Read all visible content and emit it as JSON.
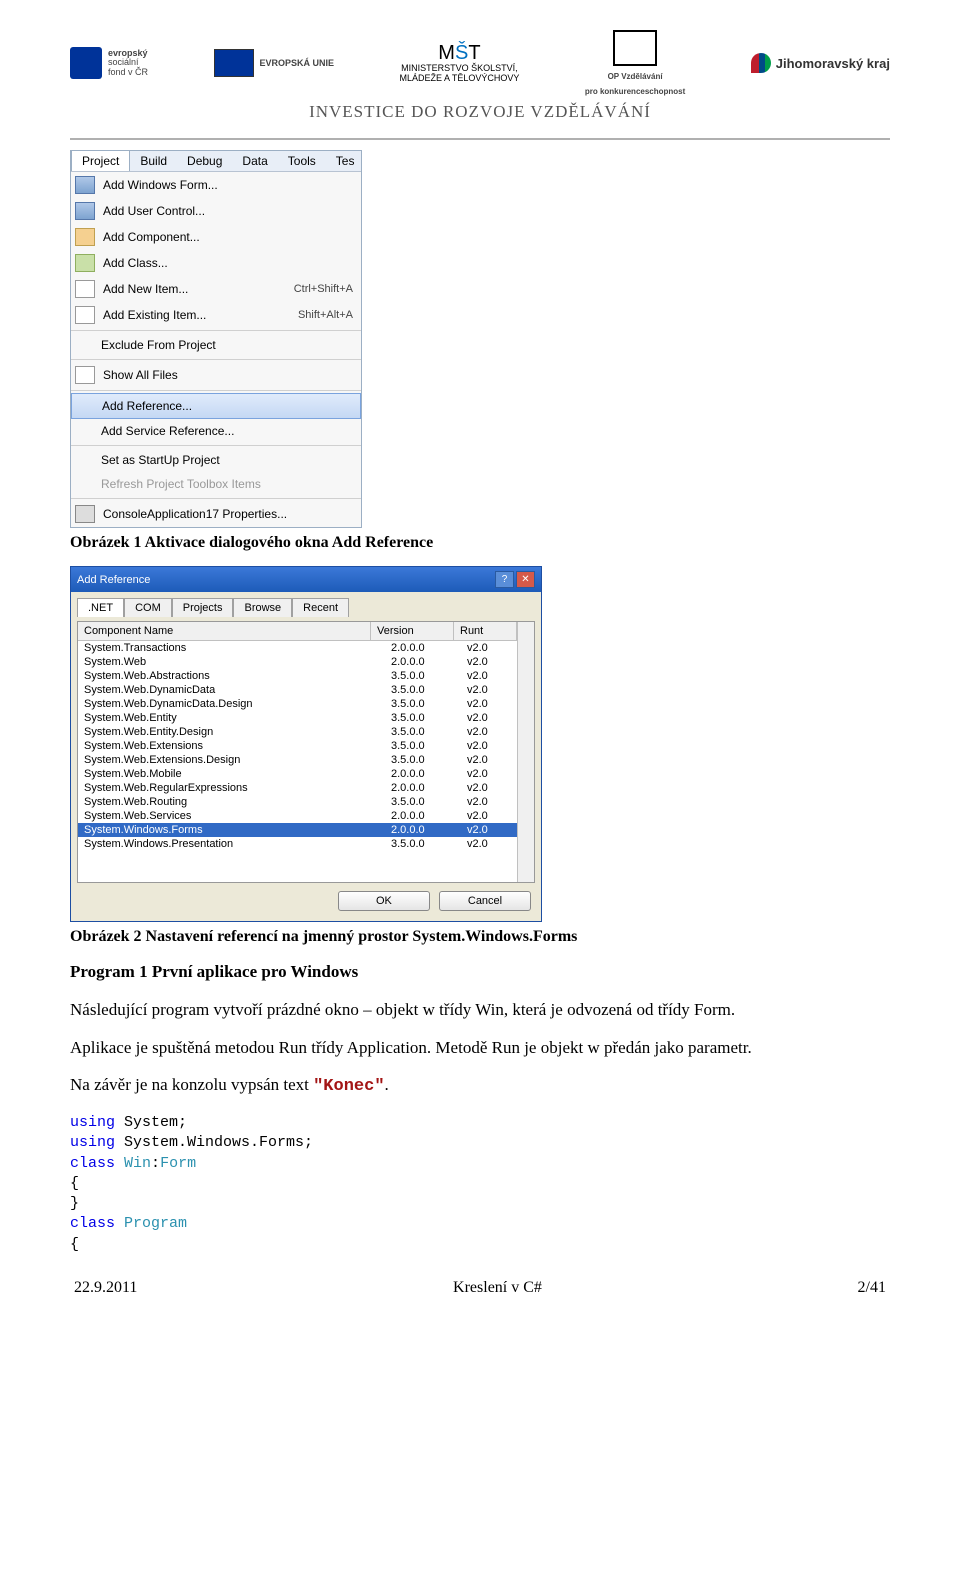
{
  "header": {
    "logos": {
      "esf_lines": [
        "evropský",
        "sociální",
        "fond v ČR"
      ],
      "eu_label": "EVROPSKÁ UNIE",
      "msmt_lines": [
        "MINISTERSTVO ŠKOLSTVÍ,",
        "MLÁDEŽE A TĚLOVÝCHOVY"
      ],
      "opvk_lines": [
        "OP Vzdělávání",
        "pro konkurenceschopnost"
      ],
      "jmk": "Jihomoravský kraj"
    },
    "investice": "INVESTICE DO ROZVOJE VZDĚLÁVÁNÍ"
  },
  "vs_menu": {
    "bar": [
      "Project",
      "Build",
      "Debug",
      "Data",
      "Tools",
      "Tes"
    ],
    "active_bar": "Project",
    "items": [
      {
        "label": "Add Windows Form...",
        "icon": "form"
      },
      {
        "label": "Add User Control...",
        "icon": "form"
      },
      {
        "label": "Add Component...",
        "icon": "comp"
      },
      {
        "label": "Add Class...",
        "icon": "class"
      },
      {
        "label": "Add New Item...",
        "icon": "item",
        "shortcut": "Ctrl+Shift+A"
      },
      {
        "label": "Add Existing Item...",
        "icon": "item",
        "shortcut": "Shift+Alt+A"
      },
      {
        "sep": true
      },
      {
        "label": "Exclude From Project",
        "icon": ""
      },
      {
        "sep": true
      },
      {
        "label": "Show All Files",
        "icon": "item"
      },
      {
        "sep": true
      },
      {
        "label": "Add Reference...",
        "icon": "",
        "selected": true
      },
      {
        "label": "Add Service Reference...",
        "icon": ""
      },
      {
        "sep": true
      },
      {
        "label": "Set as StartUp Project",
        "icon": ""
      },
      {
        "label": "Refresh Project Toolbox Items",
        "icon": "",
        "disabled": true
      },
      {
        "sep": true
      },
      {
        "label": "ConsoleApplication17 Properties...",
        "icon": "prop"
      }
    ]
  },
  "caption1": "Obrázek 1 Aktivace dialogového okna Add Reference",
  "dialog": {
    "title": "Add Reference",
    "tabs": [
      ".NET",
      "COM",
      "Projects",
      "Browse",
      "Recent"
    ],
    "active_tab": ".NET",
    "headers": {
      "c1": "Component Name",
      "c2": "Version",
      "c3": "Runt"
    },
    "rows": [
      {
        "n": "System.Transactions",
        "v": "2.0.0.0",
        "r": "v2.0"
      },
      {
        "n": "System.Web",
        "v": "2.0.0.0",
        "r": "v2.0"
      },
      {
        "n": "System.Web.Abstractions",
        "v": "3.5.0.0",
        "r": "v2.0"
      },
      {
        "n": "System.Web.DynamicData",
        "v": "3.5.0.0",
        "r": "v2.0"
      },
      {
        "n": "System.Web.DynamicData.Design",
        "v": "3.5.0.0",
        "r": "v2.0"
      },
      {
        "n": "System.Web.Entity",
        "v": "3.5.0.0",
        "r": "v2.0"
      },
      {
        "n": "System.Web.Entity.Design",
        "v": "3.5.0.0",
        "r": "v2.0"
      },
      {
        "n": "System.Web.Extensions",
        "v": "3.5.0.0",
        "r": "v2.0"
      },
      {
        "n": "System.Web.Extensions.Design",
        "v": "3.5.0.0",
        "r": "v2.0"
      },
      {
        "n": "System.Web.Mobile",
        "v": "2.0.0.0",
        "r": "v2.0"
      },
      {
        "n": "System.Web.RegularExpressions",
        "v": "2.0.0.0",
        "r": "v2.0"
      },
      {
        "n": "System.Web.Routing",
        "v": "3.5.0.0",
        "r": "v2.0"
      },
      {
        "n": "System.Web.Services",
        "v": "2.0.0.0",
        "r": "v2.0"
      },
      {
        "n": "System.Windows.Forms",
        "v": "2.0.0.0",
        "r": "v2.0",
        "sel": true
      },
      {
        "n": "System.Windows.Presentation",
        "v": "3.5.0.0",
        "r": "v2.0"
      }
    ],
    "ok": "OK",
    "cancel": "Cancel"
  },
  "caption2": "Obrázek 2 Nastavení referencí na jmenný prostor System.Windows.Forms",
  "section_heading": "Program 1 První aplikace pro Windows",
  "paragraphs": {
    "p1a": "Následující program vytvoří prázdné okno – objekt w třídy Win, která je odvozená od třídy Form.",
    "p2": "Aplikace je spuštěná metodou Run třídy Application. Metodě Run je objekt w předán jako parametr.",
    "p3a": "Na závěr je na konzolu vypsán text ",
    "p3b": "\"Konec\"",
    "p3c": "."
  },
  "code": {
    "l1a": "using",
    "l1b": " System;",
    "l2a": "using",
    "l2b": " System.Windows.Forms;",
    "l3a": "class",
    "l3b": " ",
    "l3c": "Win",
    "l3d": ":",
    "l3e": "Form",
    "l4": "{",
    "l5": "}",
    "l6a": "class",
    "l6b": " ",
    "l6c": "Program",
    "l7": "{"
  },
  "footer": {
    "left": "22.9.2011",
    "center": "Kreslení v C#",
    "right": "2/41"
  }
}
